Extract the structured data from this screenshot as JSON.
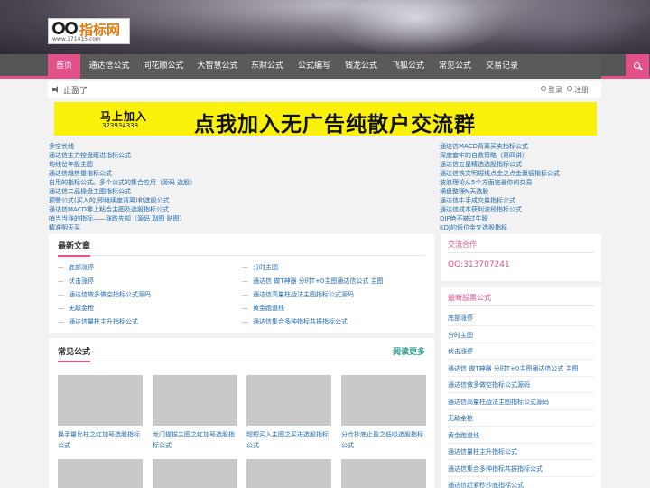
{
  "header": {
    "logo_text": "指标网",
    "logo_url": "www.171415.com"
  },
  "nav": {
    "items": [
      {
        "label": "首页",
        "active": true
      },
      {
        "label": "通达信公式"
      },
      {
        "label": "同花顺公式"
      },
      {
        "label": "大智慧公式"
      },
      {
        "label": "东财公式"
      },
      {
        "label": "公式编写"
      },
      {
        "label": "钱龙公式"
      },
      {
        "label": "飞狐公式"
      },
      {
        "label": "常见公式"
      },
      {
        "label": "交易记录"
      }
    ],
    "search_icon": "search-icon"
  },
  "notice": {
    "message": "止盈了",
    "login": "登录",
    "register": "注册"
  },
  "banner": {
    "small_text": "马上加入",
    "qq": "323934338",
    "big_text": "点我加入无广告纯散户交流群"
  },
  "left_links": [
    "多空长线",
    "通达信主力控盘跟进指标公式",
    "均线岔年股主图",
    "通达信趋势量指标公式",
    "自用的指标公式。多个公式的集合应用（源码 选股）",
    "通达信二品操盘主图指标公式",
    "预警公式(买入的,即继续度背离)和选股公式",
    "通达信MACD零上粘合主图及选股指标公式",
    "哨当当涨的指标——涨跌先知（源码 副图 贴图）",
    "精准明天买"
  ],
  "right_links": [
    "通达信MACD背离买卖指标公式",
    "深度套牢的自救策略（第四讲）",
    "通达信五星精选选股指标公式",
    "通达信铁文明短线点金之点金赢低指标公式",
    "波浪理论从5个方面完善你的交易",
    "横盘整理N天选股",
    "通达信牛手成交量指标公式",
    "通达信成本获利波段指标公式",
    "DIF绝不被过牛股",
    "KDJ的低位金叉选股指标"
  ],
  "latest": {
    "title": "最新文章",
    "left": [
      "底部涨停",
      "伏击涨停",
      "通达信做多做空指标公式源码",
      "无敌金枪",
      "通达信量柱主升指标公式"
    ],
    "right": [
      "分时主图",
      "通达信 做T神器 分时T+0主图通达信公式 主图",
      "通达信高量柱战法主图指标公式源码",
      "黄金跑道线",
      "通达信集合多种指标共振指标公式"
    ]
  },
  "common": {
    "title": "常见公式",
    "more": "阅读更多",
    "items": [
      "换手量比柱之红加号选股指标公式",
      "龙门提拔主图之红加号选股指标公式",
      "超短买入主图之买进选股指标公式",
      "分仓抄底止盈之低吸选股指标公式"
    ]
  },
  "contact": {
    "title": "交流合作",
    "qq": "QQ:313707241"
  },
  "newest": {
    "title": "最新股票公式",
    "items": [
      "底部涨停",
      "分时主图",
      "伏击涨停",
      "通达信 做T神器 分时T+0主图通达信公式 主图",
      "通达信做多做空指标公式源码",
      "通达信高量柱战法主图指标公式源码",
      "无敌金枪",
      "黄金跑道线",
      "通达信量柱主升指标公式",
      "通达信集合多种指标共振指标公式",
      "通达信赶紧秒抄底指标公式"
    ]
  },
  "colors": {
    "accent": "#e3518a",
    "link": "#1f6ab1",
    "nav_bg": "#5a5a5a",
    "banner": "#f9f10a"
  }
}
